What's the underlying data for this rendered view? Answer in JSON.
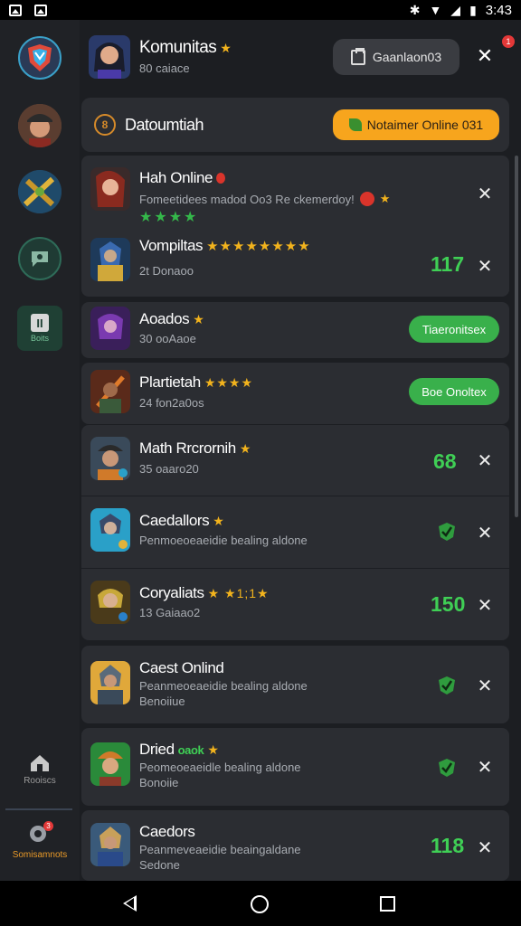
{
  "status_bar": {
    "time": "3:43"
  },
  "sidebar": {
    "bottom_items": [
      {
        "label": "Rooiscs"
      },
      {
        "label": "Somisamnots",
        "badge": "3"
      }
    ],
    "tile_label": "Boits"
  },
  "header": {
    "title": "Komunitas",
    "subtitle": "80 caiace",
    "button_label": "Gaanlaon03",
    "badge": "1"
  },
  "banner": {
    "title": "Datoumtiah",
    "cta_label": "Notaimer Online 031"
  },
  "cards": [
    {
      "rows": [
        {
          "name": "Hah Online",
          "sub": "Fomeetidees madod Oo3 Re ckemerdoy!",
          "stars": "★★★★",
          "action": "close"
        },
        {
          "name": "Vompiltas",
          "sub": "2t Donaoo",
          "stars": "★★★★★★★★",
          "count": "117",
          "action": "close"
        }
      ]
    },
    {
      "rows": [
        {
          "name": "Aoados",
          "sub": "30 ooAaoe",
          "pill": "Tiaeronitsex"
        }
      ]
    },
    {
      "rows": [
        {
          "name": "Plartietah",
          "sub": "24 fon2a0os",
          "stars": "★★★★",
          "pill": "Boe Onoltex"
        }
      ]
    },
    {
      "rows": [
        {
          "name": "Math Rrcrornih",
          "sub": "35 oaaro20",
          "count": "68",
          "action": "close"
        },
        {
          "name": "Caedallors",
          "sub": "Penmoeoeaeidie bealing aldone",
          "action": "check-close"
        },
        {
          "name": "Coryaliats",
          "sub": "13 Gaiaao2",
          "stars": "★ ★1;1★",
          "count": "150",
          "action": "close"
        }
      ]
    },
    {
      "rows": [
        {
          "name": "Caest Onlind",
          "sub": "Peanmeoeaeidie bealing aldone",
          "sub2": "Benoiiue",
          "action": "check-close"
        }
      ]
    },
    {
      "rows": [
        {
          "name": "Dried",
          "tag": "oaok",
          "sub": "Peomeoeaeidle bealing aldone",
          "sub2": "Bonoiie",
          "action": "check-close"
        }
      ]
    },
    {
      "rows": [
        {
          "name": "Caedors",
          "sub": "Peanmeveaeidie beaingaldane",
          "sub2": "Sedone",
          "count": "118",
          "action": "close"
        }
      ]
    }
  ],
  "colors": {
    "accent_orange": "#f7a51d",
    "accent_green": "#3fcf55",
    "pill_green": "#39b04b",
    "card_bg": "#2b2d32",
    "page_bg": "#1c1e22"
  }
}
